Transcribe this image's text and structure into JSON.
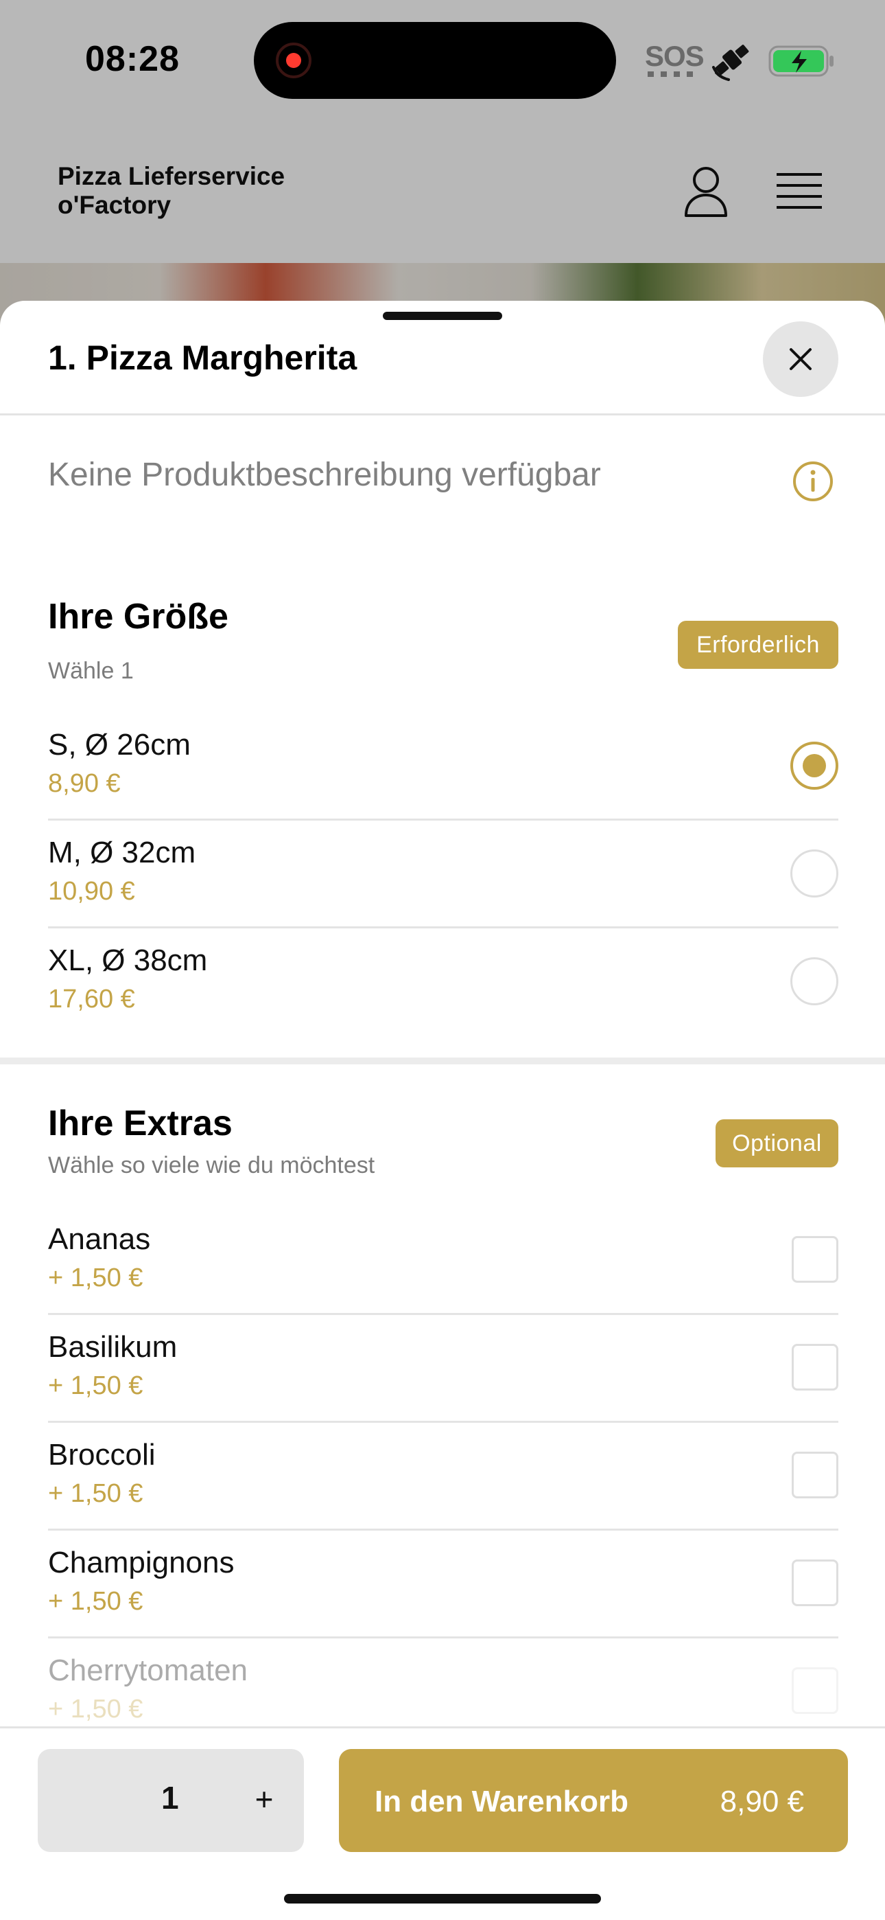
{
  "status_bar": {
    "time": "08:28",
    "sos": "SOS",
    "icons": [
      "screen-recording-icon",
      "satellite-icon",
      "battery-charging-icon"
    ],
    "battery_color": "#34c759"
  },
  "background_page": {
    "brand": "Pizza Lieferservice o'Factory",
    "icons": [
      "user-icon",
      "menu-icon"
    ]
  },
  "sheet": {
    "title": "1. Pizza Margherita",
    "description": "Keine Produktbeschreibung verfügbar"
  },
  "size_section": {
    "title": "Ihre Größe",
    "subtitle": "Wähle 1",
    "badge": "Erforderlich",
    "options": [
      {
        "name": "S, Ø 26cm",
        "price": "8,90 €",
        "selected": true
      },
      {
        "name": "M, Ø 32cm",
        "price": "10,90 €",
        "selected": false
      },
      {
        "name": "XL, Ø 38cm",
        "price": "17,60 €",
        "selected": false
      }
    ]
  },
  "extras_section": {
    "title": "Ihre Extras",
    "subtitle": "Wähle so viele wie du möchtest",
    "badge": "Optional",
    "items": [
      {
        "name": "Ananas",
        "price": "+ 1,50 €",
        "checked": false
      },
      {
        "name": "Basilikum",
        "price": "+ 1,50 €",
        "checked": false
      },
      {
        "name": "Broccoli",
        "price": "+ 1,50 €",
        "checked": false
      },
      {
        "name": "Champignons",
        "price": "+ 1,50 €",
        "checked": false
      },
      {
        "name": "Cherrytomaten",
        "price": "+ 1,50 €",
        "checked": false
      }
    ]
  },
  "footer": {
    "quantity": "1",
    "plus": "+",
    "cart_label": "In den Warenkorb",
    "cart_price": "8,90 €"
  },
  "colors": {
    "accent": "#c4a447",
    "divider": "#e4e4e4",
    "control_bg": "#e5e5e5"
  }
}
